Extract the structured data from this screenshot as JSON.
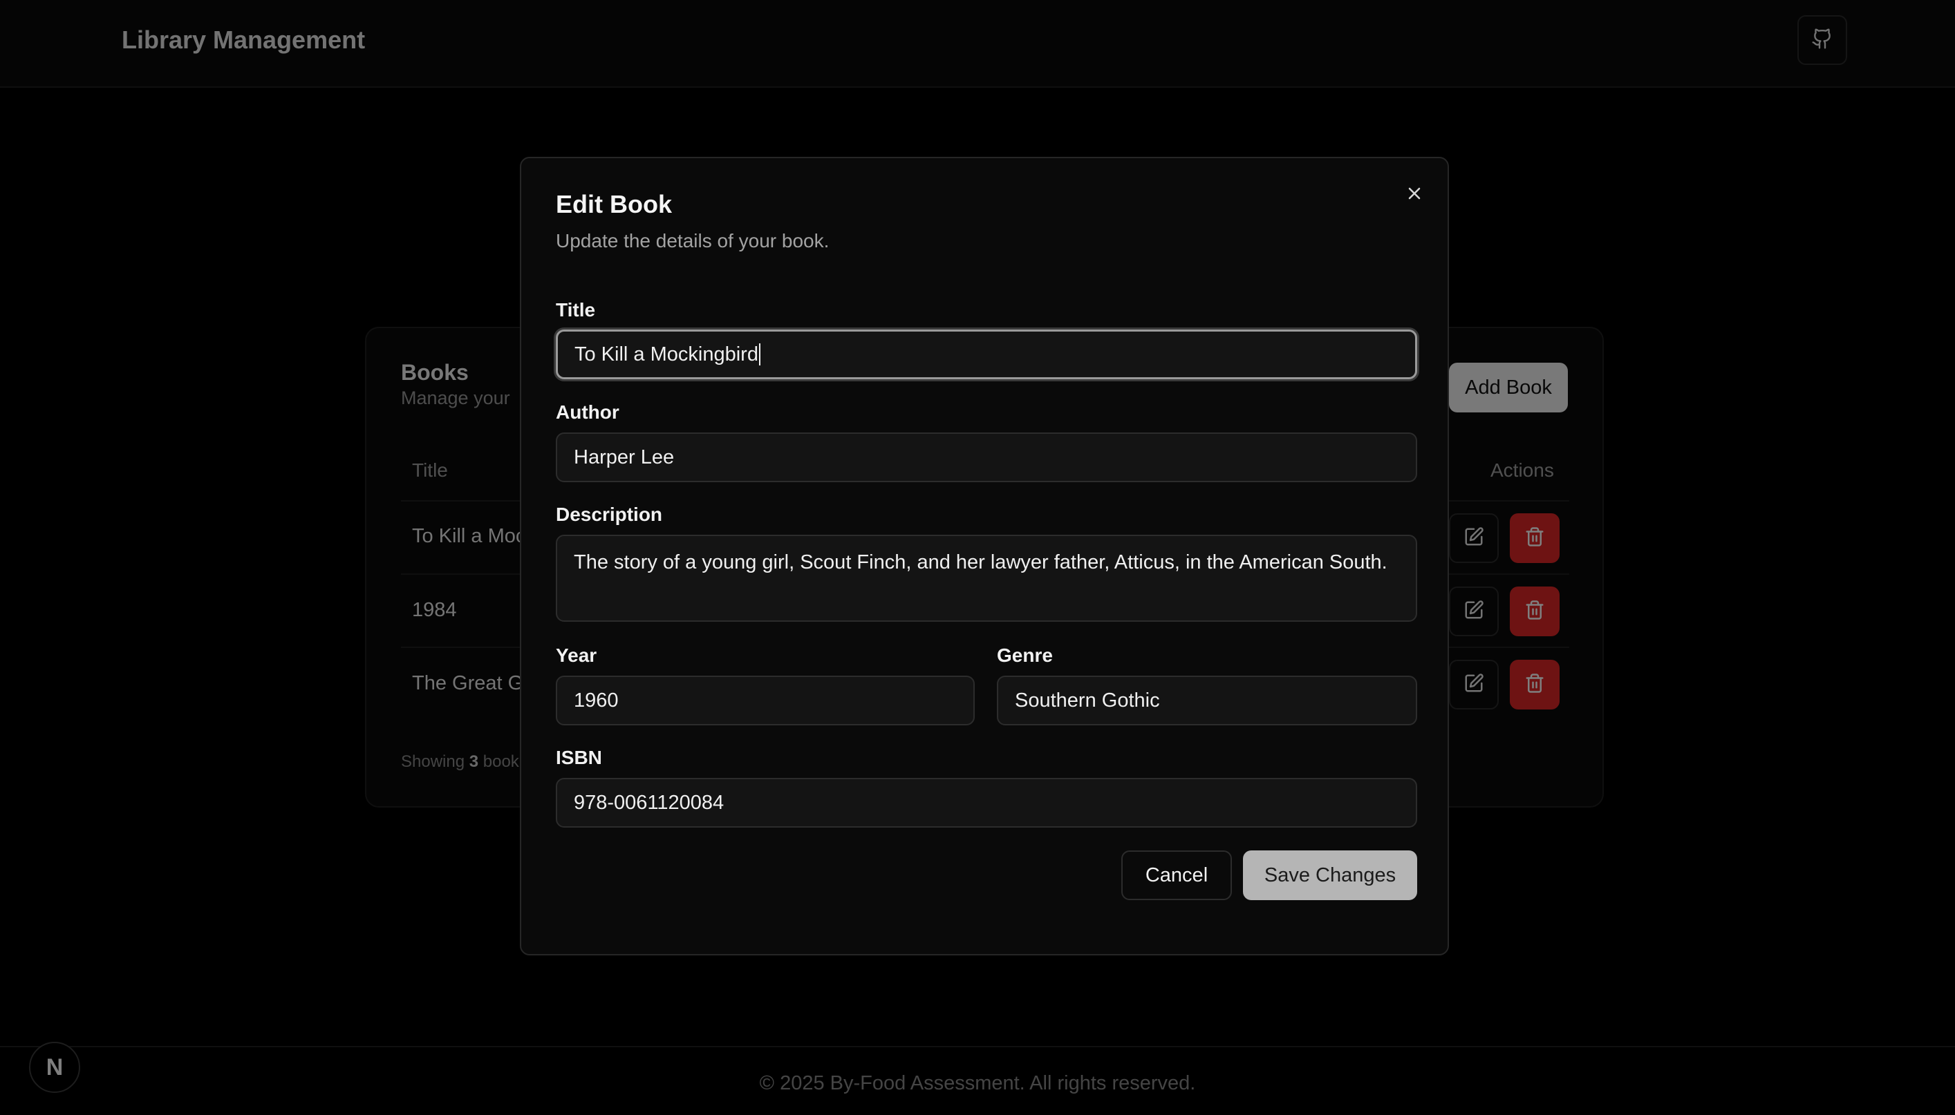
{
  "header": {
    "app_title": "Library Management",
    "github_icon": "github-icon"
  },
  "books_card": {
    "title": "Books",
    "subtitle": "Manage your",
    "add_book_label": "Add Book",
    "columns": {
      "title": "Title",
      "actions": "Actions"
    },
    "rows": [
      {
        "title": "To Kill a Moc"
      },
      {
        "title": "1984"
      },
      {
        "title": "The Great G"
      }
    ],
    "showing_prefix": "Showing ",
    "showing_count": "3",
    "showing_suffix": " book"
  },
  "modal": {
    "title": "Edit Book",
    "description": "Update the details of your book.",
    "fields": {
      "title": {
        "label": "Title",
        "value": "To Kill a Mockingbird"
      },
      "author": {
        "label": "Author",
        "value": "Harper Lee"
      },
      "description": {
        "label": "Description",
        "value": "The story of a young girl, Scout Finch, and her lawyer father, Atticus, in the American South."
      },
      "year": {
        "label": "Year",
        "value": "1960"
      },
      "genre": {
        "label": "Genre",
        "value": "Southern Gothic"
      },
      "isbn": {
        "label": "ISBN",
        "value": "978-0061120084"
      }
    },
    "cancel_label": "Cancel",
    "save_label": "Save Changes",
    "close_glyph": "×"
  },
  "footer": {
    "text": "© 2025 By-Food Assessment. All rights reserved.",
    "badge_letter": "N"
  },
  "colors": {
    "background": "#000000",
    "delete_red": "#dc2626",
    "primary_button": "#f2f2f2"
  }
}
